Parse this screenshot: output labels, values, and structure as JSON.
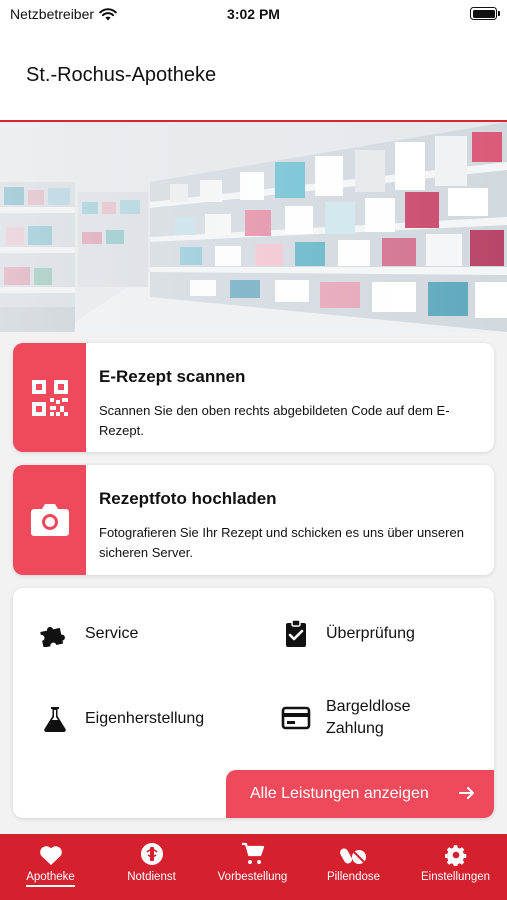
{
  "status": {
    "carrier": "Netzbetreiber",
    "time": "3:02 PM"
  },
  "header": {
    "title": "St.-Rochus-Apotheke"
  },
  "cards": [
    {
      "title": "E-Rezept scannen",
      "description": "Scannen Sie den oben rechts abgebildeten Code auf dem E-Rezept.",
      "icon": "qr-code-icon"
    },
    {
      "title": "Rezeptfoto hochladen",
      "description": "Fotografieren Sie Ihr Rezept und schicken es uns über unseren sicheren Server.",
      "icon": "camera-icon"
    }
  ],
  "services": {
    "items": [
      {
        "label": "Service",
        "icon": "puzzle-icon"
      },
      {
        "label": "Überprüfung",
        "icon": "clipboard-check-icon"
      },
      {
        "label": "Eigenherstellung",
        "icon": "flask-icon"
      },
      {
        "label": "Bargeldlose Zahlung",
        "icon": "credit-card-icon"
      }
    ],
    "all_label": "Alle Leistungen anzeigen"
  },
  "nav": {
    "items": [
      {
        "label": "Apotheke",
        "icon": "heart-icon",
        "active": true
      },
      {
        "label": "Notdienst",
        "icon": "pharmacy-sign-icon",
        "active": false
      },
      {
        "label": "Vorbestellung",
        "icon": "cart-icon",
        "active": false
      },
      {
        "label": "Pillendose",
        "icon": "pills-icon",
        "active": false
      },
      {
        "label": "Einstellungen",
        "icon": "gear-icon",
        "active": false
      }
    ]
  },
  "colors": {
    "brand_red": "#d5202e",
    "accent_red": "#ef4a5b"
  }
}
